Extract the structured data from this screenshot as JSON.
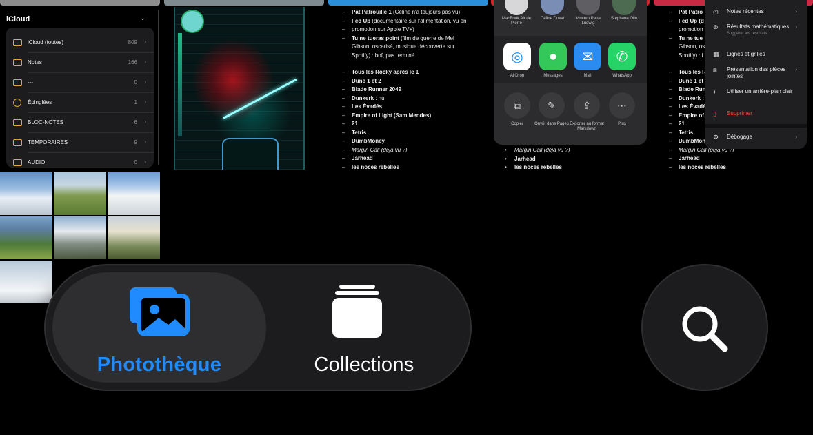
{
  "notes_folders": {
    "header": "iCloud",
    "items": [
      {
        "label": "iCloud (toutes)",
        "count": "809"
      },
      {
        "label": "Notes",
        "count": "166"
      },
      {
        "label": "---",
        "count": "0"
      },
      {
        "label": "Épinglées",
        "count": "1"
      },
      {
        "label": "BLOC-NOTES",
        "count": "6"
      },
      {
        "label": "TEMPORAIRES",
        "count": "9"
      },
      {
        "label": "AUDIO",
        "count": "0"
      }
    ]
  },
  "note_text": {
    "l1a": "Pat Patrouille 1",
    "l1b": " (Céline n'a toujours pas vu)",
    "l2a": "Fed Up",
    "l2b": " (documentaire sur l'alimentation, vu en",
    "l2c": "promotion sur Apple TV+)",
    "l3a": "Tu ne tueras point",
    "l3b": " (film de guerre de Mel",
    "l3c": "Gibson, oscarisé, musique découverte sur",
    "l3d": "Spotify) : bof, pas terminé",
    "l4": "Tous les Rocky après le 1",
    "l5": "Dune 1 et 2",
    "l6": "Blade Runner 2049",
    "l7a": "Dunkerk",
    "l7b": " : nul",
    "l8": "Les Évadés",
    "l9": "Empire of Light (Sam Mendes)",
    "l10": "21",
    "l11": "Tetris",
    "l12": "DumbMoney",
    "l13": "Margin Call (déjà vu ?)",
    "l14": "Jarhead",
    "l15": "les noces rebelles"
  },
  "note_text_right": {
    "r1": "Pat Patro",
    "r2": "Fed Up (d",
    "r3": "promotion",
    "r4": "Tu ne tue",
    "r5": "Gibson, os",
    "r6": "Spotify) : l",
    "r7": "Tous les R",
    "r8": "Dune 1 et",
    "r9": "Blade Run",
    "r10": "Dunkerk :",
    "r11": "Les Évadé",
    "r12": "Empire of",
    "r13": "21",
    "r14": "Tetris",
    "r15": "DumbMon",
    "r16": "Margin Call (déjà vu ?)",
    "r17": "Jarhead",
    "r18": "les noces rebelles"
  },
  "share_sheet": {
    "people": [
      {
        "name": "MacBook Air de Pierre"
      },
      {
        "name": "Céline Duval"
      },
      {
        "name": "Vincent Papa Ludwig"
      },
      {
        "name": "Stephane Olin"
      }
    ],
    "apps": [
      "AirDrop",
      "Messages",
      "Mail",
      "WhatsApp"
    ],
    "actions": [
      "Copier",
      "Ouvrir dans Pages",
      "Exporter au format Markdown",
      "Plus"
    ],
    "below": {
      "l1": "Margin Call (déjà vu ?)",
      "l2": "Jarhead",
      "l3": "les noces rebelles"
    }
  },
  "context_menu": {
    "items": [
      {
        "label": "Notes récentes",
        "sub": ""
      },
      {
        "label": "Résultats mathématiques",
        "sub": "Suggérer les résultats"
      },
      {
        "label": "Lignes et grilles",
        "sub": ""
      },
      {
        "label": "Présentation des pièces jointes",
        "sub": ""
      },
      {
        "label": "Utiliser un arrière-plan clair",
        "sub": ""
      },
      {
        "label": "Supprimer",
        "sub": ""
      },
      {
        "label": "Débogage",
        "sub": ""
      }
    ]
  },
  "tabbar": {
    "library_label": "Photothèque",
    "collections_label": "Collections",
    "accent_color": "#1f8bff"
  },
  "search": {
    "icon": "magnifying-glass"
  }
}
